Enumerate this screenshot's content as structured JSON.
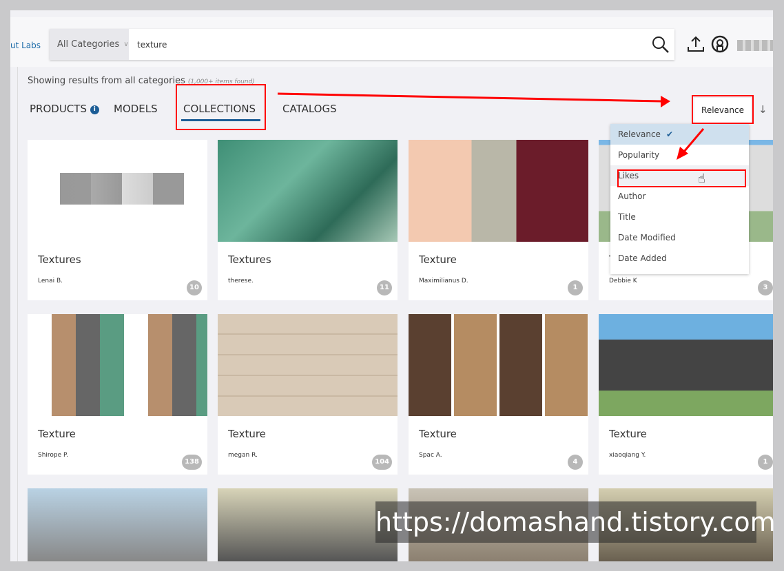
{
  "header": {
    "brand_partial": "ut Labs",
    "category": "All Categories",
    "search_value": "texture"
  },
  "results": {
    "showing": "Showing results from all categories",
    "count": "(1,000+ items found)"
  },
  "tabs": [
    {
      "label": "PRODUCTS"
    },
    {
      "label": "MODELS"
    },
    {
      "label": "COLLECTIONS",
      "active": true
    },
    {
      "label": "CATALOGS"
    }
  ],
  "sort": {
    "selected": "Relevance",
    "options": [
      "Relevance",
      "Popularity",
      "Likes",
      "Author",
      "Title",
      "Date Modified",
      "Date Added"
    ],
    "highlighted": "Likes"
  },
  "cards": [
    {
      "title": "Textures",
      "author": "Lenai B.",
      "count": "10"
    },
    {
      "title": "Textures",
      "author": "therese.",
      "count": "11"
    },
    {
      "title": "Texture",
      "author": "Maximilianus D.",
      "count": "1"
    },
    {
      "title": "Texture",
      "author": "Debbie K",
      "count": "3"
    },
    {
      "title": "Texture",
      "author": "Shirope P.",
      "count": "138"
    },
    {
      "title": "Texture",
      "author": "megan R.",
      "count": "104"
    },
    {
      "title": "Texture",
      "author": "Spac A.",
      "count": "4"
    },
    {
      "title": "Texture",
      "author": "xiaoqiang Y.",
      "count": "1"
    },
    {
      "title": "",
      "author": "",
      "count": ""
    },
    {
      "title": "",
      "author": "",
      "count": ""
    },
    {
      "title": "",
      "author": "",
      "count": ""
    },
    {
      "title": "",
      "author": "",
      "count": ""
    }
  ],
  "watermark": "https://domashand.tistory.com",
  "colors": {
    "accent": "#1c5d96",
    "annotation": "#ff0000"
  }
}
